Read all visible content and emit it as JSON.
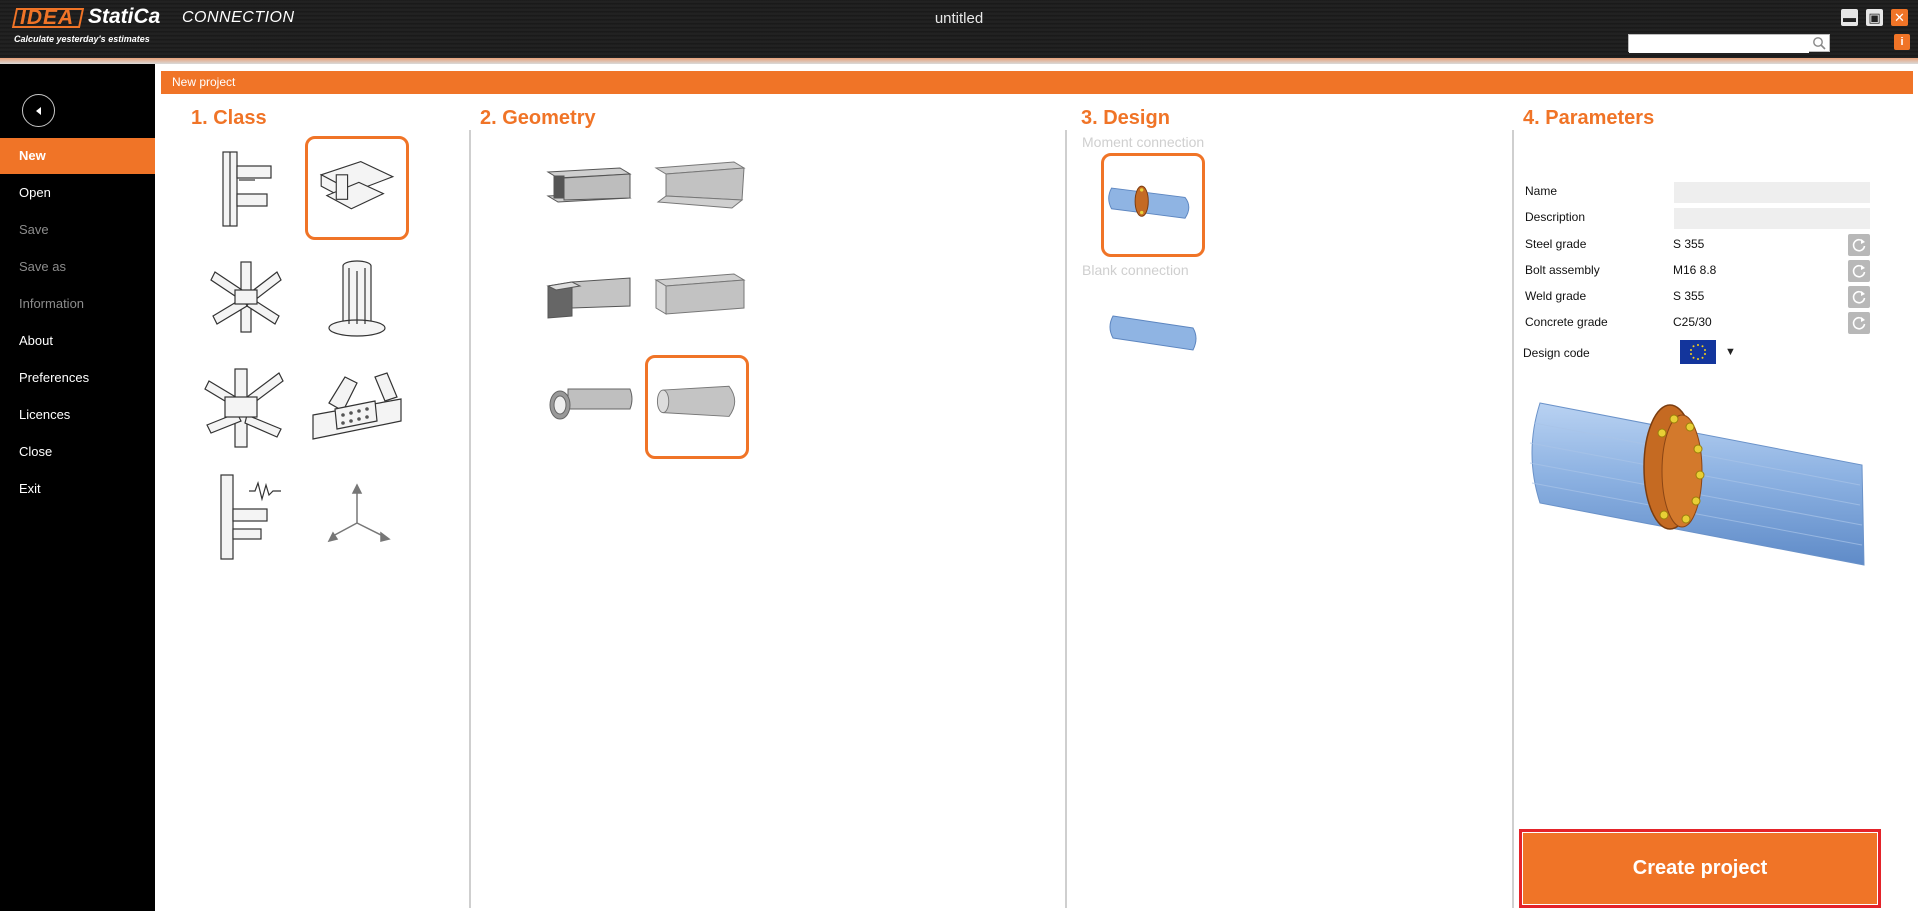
{
  "app": {
    "logo_brand": "IDEA",
    "logo_product_name": "StatiCa",
    "logo_module": "CONNECTION",
    "tagline": "Calculate yesterday's estimates",
    "window_title": "untitled"
  },
  "titlebar": {
    "minimize": "▬",
    "maximize": "▣",
    "close": "✕",
    "info": "i",
    "search_value": ""
  },
  "sidebar": {
    "items": [
      {
        "label": "New",
        "state": "active"
      },
      {
        "label": "Open",
        "state": "normal"
      },
      {
        "label": "Save",
        "state": "disabled"
      },
      {
        "label": "Save as",
        "state": "disabled"
      },
      {
        "label": "Information",
        "state": "disabled"
      },
      {
        "label": "About",
        "state": "normal"
      },
      {
        "label": "Preferences",
        "state": "normal"
      },
      {
        "label": "Licences",
        "state": "normal"
      },
      {
        "label": "Close",
        "state": "normal"
      },
      {
        "label": "Exit",
        "state": "normal"
      }
    ]
  },
  "main": {
    "header": "New project",
    "sections": {
      "class": "1.  Class",
      "geometry": "2. Geometry",
      "design": "3. Design",
      "parameters": "4. Parameters"
    },
    "design_groups": {
      "moment": "Moment connection",
      "blank": "Blank connection"
    },
    "params": {
      "name_label": "Name",
      "name_value": "",
      "description_label": "Description",
      "description_value": "",
      "steel_grade_label": "Steel grade",
      "steel_grade_value": "S 355",
      "bolt_assembly_label": "Bolt assembly",
      "bolt_assembly_value": "M16 8.8",
      "weld_grade_label": "Weld grade",
      "weld_grade_value": "S 355",
      "concrete_grade_label": "Concrete grade",
      "concrete_grade_value": "C25/30",
      "design_code_label": "Design code",
      "design_code_value": "EU flag"
    },
    "create_button": "Create project"
  },
  "colors": {
    "accent": "#f07427",
    "highlight_red": "#e4232a",
    "sidebar_bg": "#000000"
  }
}
